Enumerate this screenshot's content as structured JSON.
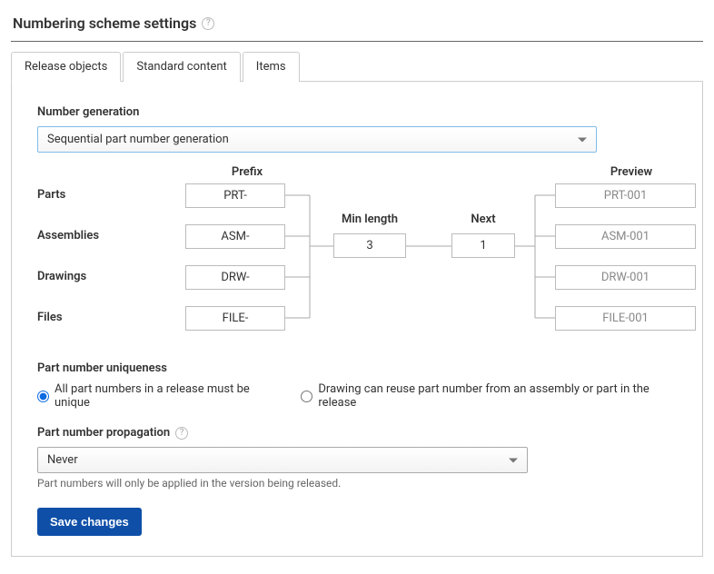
{
  "header": {
    "title": "Numbering scheme settings"
  },
  "tabs": [
    {
      "label": "Release objects",
      "active": true
    },
    {
      "label": "Standard content",
      "active": false
    },
    {
      "label": "Items",
      "active": false
    }
  ],
  "number_generation": {
    "label": "Number generation",
    "value": "Sequential part number generation"
  },
  "columns": {
    "prefix": "Prefix",
    "minlen": "Min length",
    "next": "Next",
    "preview": "Preview"
  },
  "rows": {
    "parts": {
      "label": "Parts",
      "prefix": "PRT-",
      "preview": "PRT-001"
    },
    "assemblies": {
      "label": "Assemblies",
      "prefix": "ASM-",
      "preview": "ASM-001"
    },
    "drawings": {
      "label": "Drawings",
      "prefix": "DRW-",
      "preview": "DRW-001"
    },
    "files": {
      "label": "Files",
      "prefix": "FILE-",
      "preview": "FILE-001"
    }
  },
  "shared": {
    "minlen": "3",
    "next": "1"
  },
  "uniqueness": {
    "label": "Part number uniqueness",
    "opt1": "All part numbers in a release must be unique",
    "opt2": "Drawing can reuse part number from an assembly or part in the release",
    "selected": "opt1"
  },
  "propagation": {
    "label": "Part number propagation",
    "value": "Never",
    "helper": "Part numbers will only be applied in the version being released."
  },
  "actions": {
    "save": "Save changes"
  }
}
